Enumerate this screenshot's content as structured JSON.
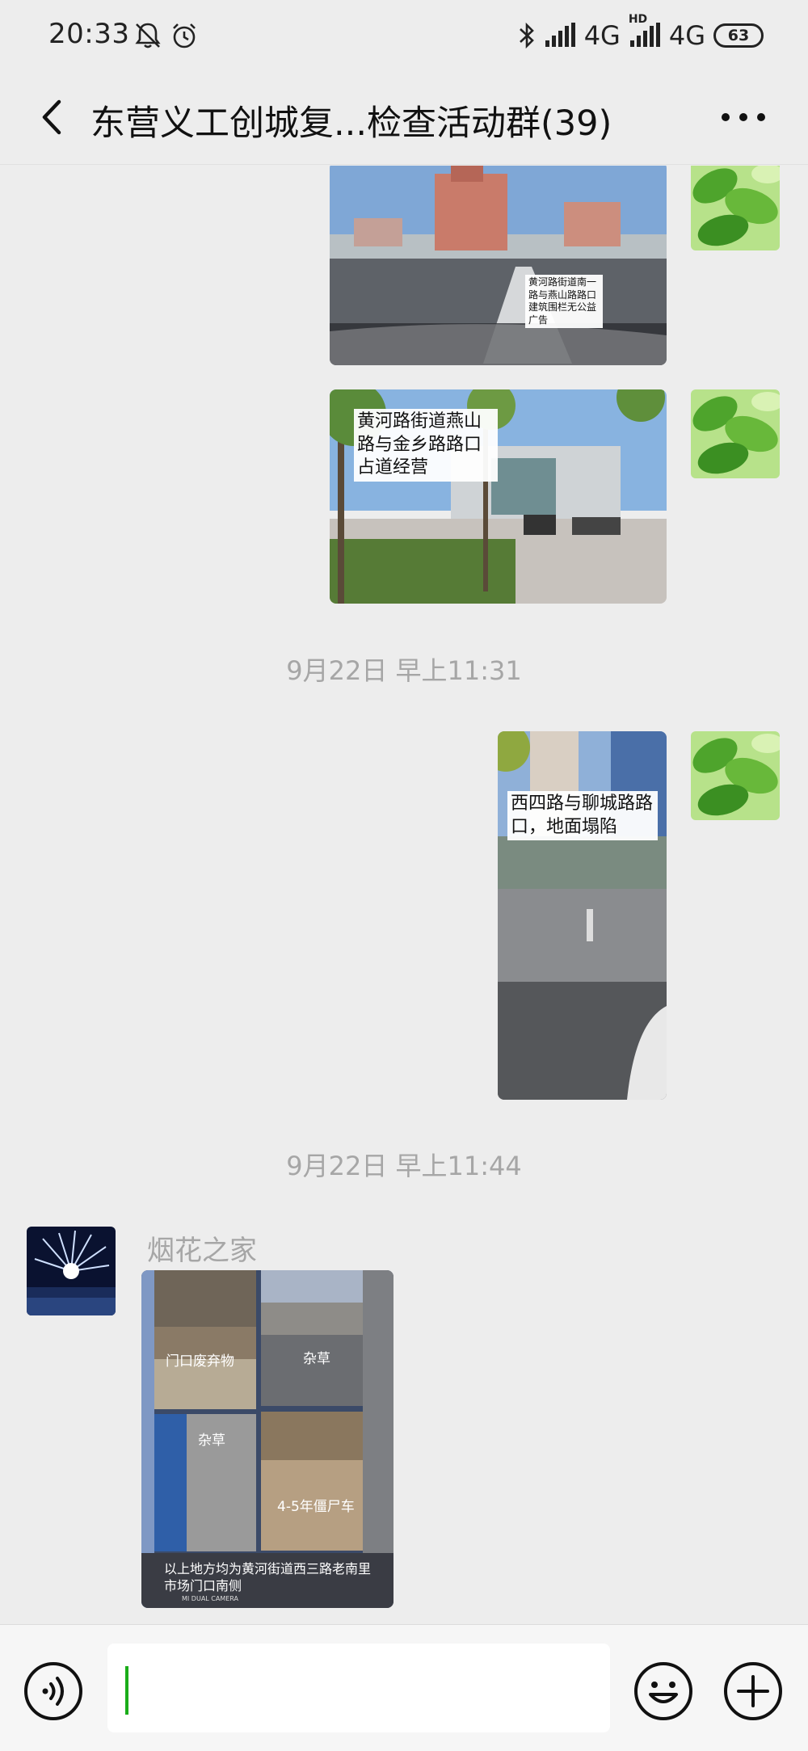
{
  "status_bar": {
    "time": "20:33",
    "network_1": "4G",
    "hd_label": "HD",
    "network_2": "4G",
    "battery": "63"
  },
  "header": {
    "title": "东营义工创城复...检查活动群(39)"
  },
  "messages": [
    {
      "caption": "黄河路街道南一路与燕山路路口建筑围栏无公益广告"
    },
    {
      "caption": "黄河路街道燕山路与金乡路路口占道经营"
    },
    {
      "timestamp": "9月22日 早上11:31"
    },
    {
      "caption": "西四路与聊城路路口，地面塌陷"
    },
    {
      "timestamp": "9月22日 早上11:44"
    },
    {
      "sender": "烟花之家",
      "collage_labels": [
        "门口废弃物",
        "杂草",
        "杂草",
        "4-5年僵尸车"
      ],
      "collage_caption": "以上地方均为黄河街道西三路老南里市场门口南侧",
      "camera_watermark": "MI DUAL CAMERA"
    }
  ],
  "icons": {
    "back": "chevron-left-icon",
    "more": "more-dots-icon",
    "voice": "voice-icon",
    "emoji": "emoji-icon",
    "plus": "plus-icon"
  },
  "colors": {
    "background": "#ededed",
    "caret": "#1aad19",
    "timestamp_text": "#a6a6a6"
  }
}
